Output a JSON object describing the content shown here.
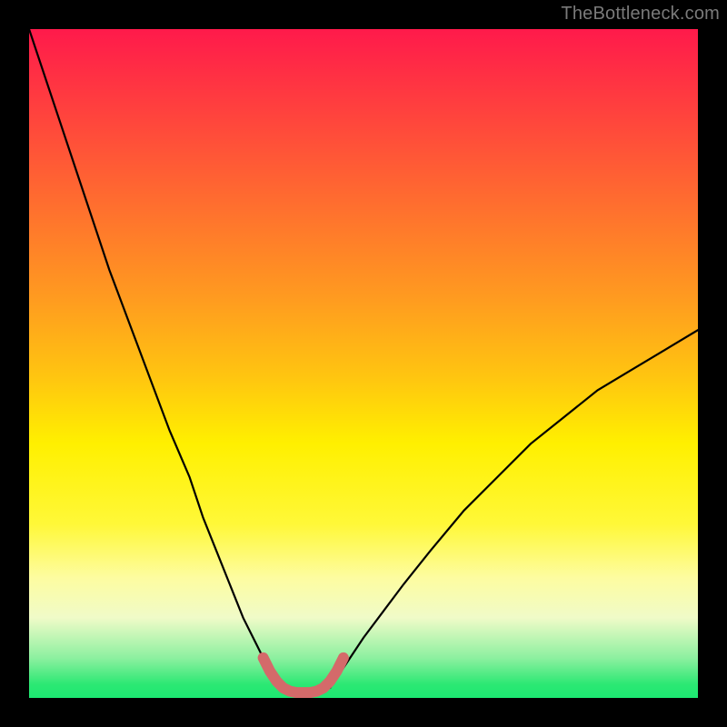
{
  "watermark": {
    "text": "TheBottleneck.com"
  },
  "colors": {
    "background": "#000000",
    "curve": "#000000",
    "highlight": "#d46a6a",
    "gradient_top": "#ff1a4b",
    "gradient_mid": "#fff000",
    "gradient_bottom": "#1de872"
  },
  "chart_data": {
    "type": "line",
    "title": "",
    "xlabel": "",
    "ylabel": "",
    "xlim": [
      0,
      100
    ],
    "ylim": [
      0,
      100
    ],
    "grid": false,
    "annotations": [],
    "series": [
      {
        "name": "left-curve",
        "x": [
          0,
          3,
          6,
          9,
          12,
          15,
          18,
          21,
          24,
          26,
          28,
          30,
          32,
          34,
          35,
          36,
          37,
          38
        ],
        "values": [
          100,
          91,
          82,
          73,
          64,
          56,
          48,
          40,
          33,
          27,
          22,
          17,
          12,
          8,
          6,
          4,
          2.5,
          1.5
        ]
      },
      {
        "name": "right-curve",
        "x": [
          45,
          46,
          48,
          50,
          53,
          56,
          60,
          65,
          70,
          75,
          80,
          85,
          90,
          95,
          100
        ],
        "values": [
          1.5,
          3,
          6,
          9,
          13,
          17,
          22,
          28,
          33,
          38,
          42,
          46,
          49,
          52,
          55
        ]
      },
      {
        "name": "bottom-highlight",
        "x": [
          35,
          36,
          37,
          38,
          39,
          40,
          41,
          42,
          43,
          44,
          45,
          46,
          47
        ],
        "values": [
          6,
          4,
          2.5,
          1.5,
          1,
          0.8,
          0.8,
          0.8,
          1,
          1.5,
          2.5,
          4,
          6
        ]
      }
    ]
  }
}
